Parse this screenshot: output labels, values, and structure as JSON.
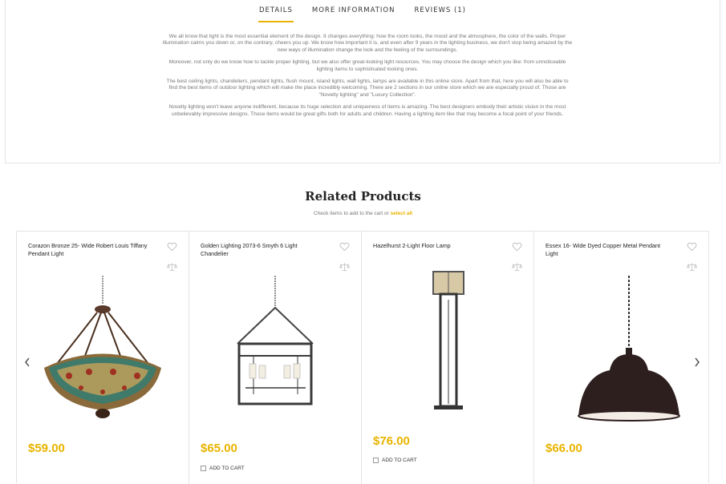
{
  "tabs": [
    {
      "label": "DETAILS",
      "active": true
    },
    {
      "label": "MORE INFORMATION",
      "active": false
    },
    {
      "label": "REVIEWS (1)",
      "active": false
    }
  ],
  "description": [
    "We all know that light is the most essential element of the design. It changes everything: how the room looks, the mood and the atmosphere, the color of the walls. Proper illumination calms you down or, on the contrary, cheers you up. We know how important it is, and even after 9 years in the lighting business, we don't stop being amazed by the new ways of illumination change the look and the feeling of the surroundings.",
    "Moreover, not only do we know how to tackle proper lighting, but we also offer great-looking light resources. You may choose the design which you like: from unnoticeable lighting items to sophisticated looking ones.",
    "The best ceiling lights, chandeliers, pendant lights, flush mount, island lights, wall lights, lamps are available in this online store. Apart from that, here you will also be able to find the best items of outdoor lighting which will make the place incredibly welcoming. There are 2 sections in our online store which we are especially proud of. Those are \"Novelty lighting\" and \"Luxury Collection\".",
    "Novelty lighting won't leave anyone indifferent, because its huge selection and uniqueness of items is amazing. The best designers embody their artistic vision in the most unbelievably impressive designs. Those items would be great gifts both for adults and children. Having a lighting item like that may become a focal point of your friends."
  ],
  "related": {
    "title": "Related Products",
    "subtitle_prefix": "Check items to add to the cart or ",
    "select_all": "select all"
  },
  "products": [
    {
      "name": "Corazon Bronze 25- Wide Robert Louis Tiffany Pendant Light",
      "price": "$59.00",
      "add_to_cart": ""
    },
    {
      "name": "Golden Lighting 2073-6 Smyth 6 Light Chandelier",
      "price": "$65.00",
      "add_to_cart": "ADD TO CART"
    },
    {
      "name": "Hazelhurst 2-Light Floor Lamp",
      "price": "$76.00",
      "add_to_cart": "ADD TO CART"
    },
    {
      "name": "Essex 16- Wide Dyed Copper Metal Pendant Light",
      "price": "$66.00",
      "add_to_cart": ""
    }
  ],
  "colors": {
    "accent": "#e8b400"
  }
}
